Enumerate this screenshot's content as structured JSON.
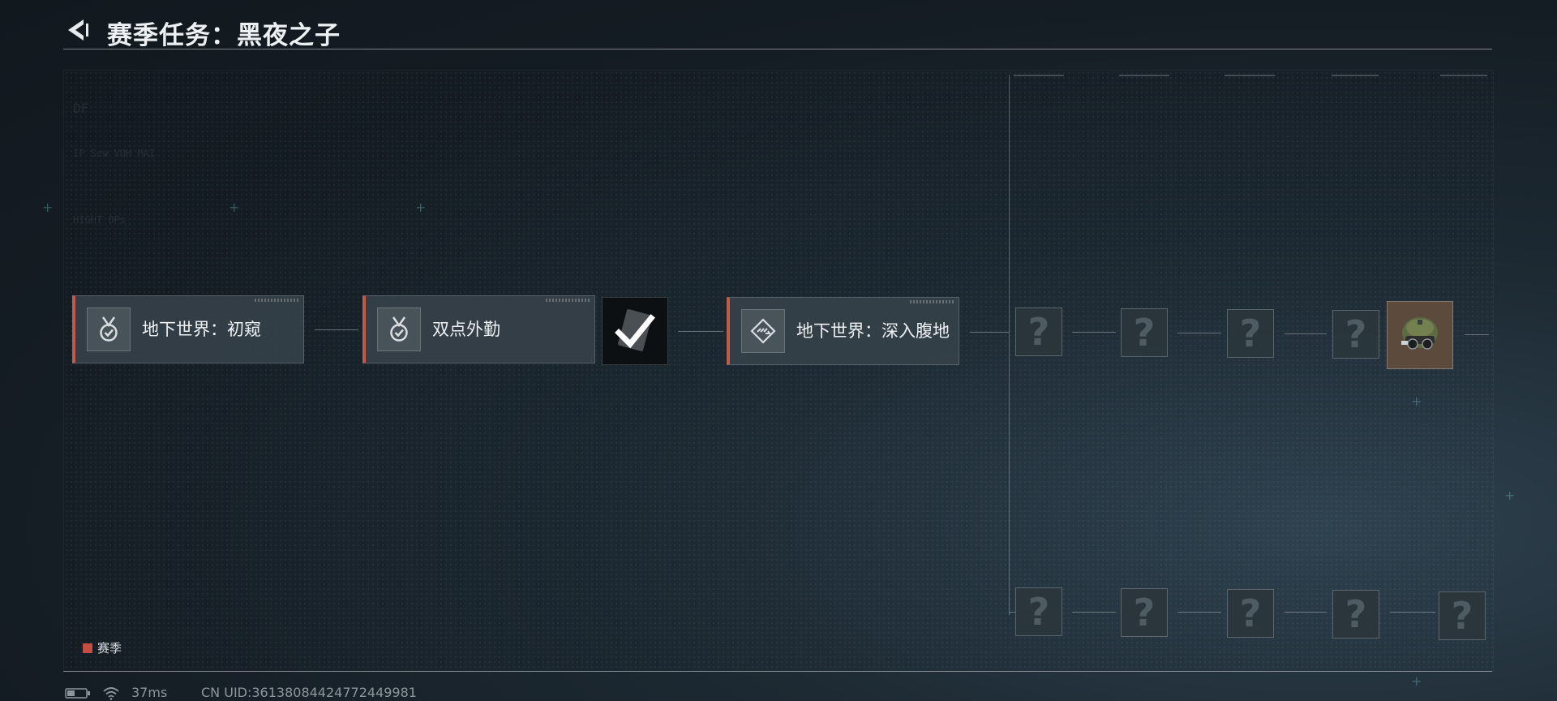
{
  "header": {
    "title": "赛季任务：黑夜之子"
  },
  "icons": {
    "back": "back-arrow-icon",
    "medal": "medal-check-icon",
    "waypoint": "waypoint-icon",
    "check": "checkmark-icon",
    "helmet": "night-vision-helmet-icon",
    "battery": "battery-icon",
    "wifi": "wifi-icon"
  },
  "tasks": [
    {
      "label": "地下世界：初窥",
      "icon": "medal-check-icon",
      "status": "completed"
    },
    {
      "label": "双点外勤",
      "icon": "medal-check-icon",
      "status": "completed"
    },
    {
      "label": "地下世界：深入腹地",
      "icon": "waypoint-icon",
      "status": "active"
    }
  ],
  "locked": {
    "glyph": "?"
  },
  "legend": {
    "label": "赛季",
    "color": "#c44e42"
  },
  "status_bar": {
    "ping": "37ms",
    "uid": "CN UID:36138084424772449981"
  },
  "faint_text": [
    "DF",
    "IP Sew VOH MAI",
    "HIGHT OPs"
  ]
}
